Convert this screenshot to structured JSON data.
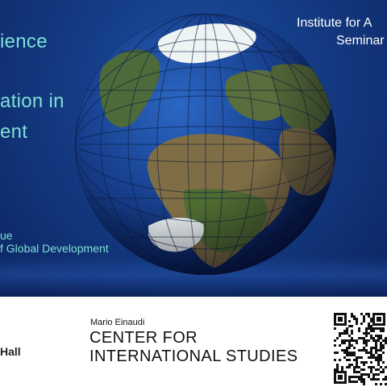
{
  "slide": {
    "title_lines": [
      "ience",
      "ation in",
      "ent"
    ],
    "subtitle_lines": [
      "ue",
      "f Global Development"
    ],
    "institute_lines": [
      "Institute for A",
      "Seminar"
    ]
  },
  "footer": {
    "left_partial": "Hall",
    "center_small": "Mario Einaudi",
    "center_big_line1": "CENTER FOR",
    "center_big_line2": "INTERNATIONAL STUDIES"
  },
  "colors": {
    "background_blue": "#143b84",
    "title_teal": "#7ee0d6",
    "institute_text": "#ffffff"
  },
  "icons": [
    "globe-image",
    "qr-code"
  ]
}
